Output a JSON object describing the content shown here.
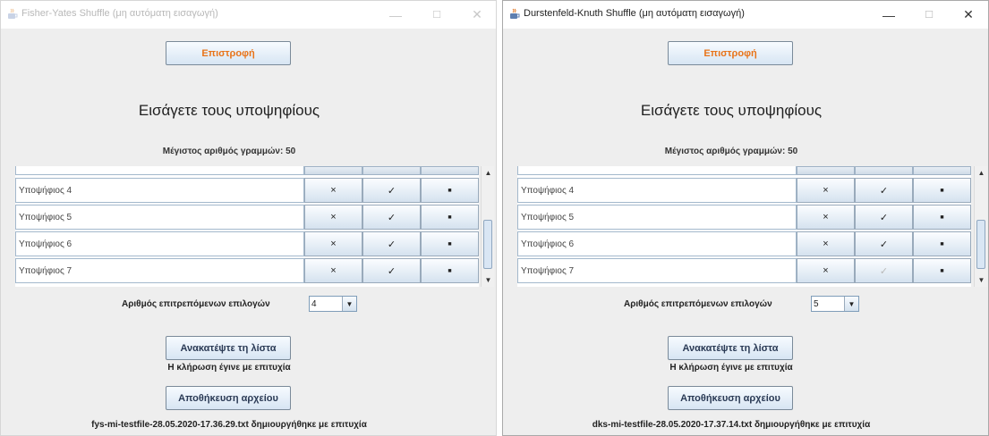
{
  "left": {
    "title": "Fisher-Yates Shuffle (μη αυτόματη εισαγωγή)",
    "back_button": "Επιστροφή",
    "heading": "Εισάγετε τους υποψηφίους",
    "max_lines": "Μέγιστος αριθμός γραμμών: 50",
    "rows": [
      {
        "name": "Υποψήφιος 4",
        "x": "×",
        "check": "✓",
        "dot": "■"
      },
      {
        "name": "Υποψήφιος 5",
        "x": "×",
        "check": "✓",
        "dot": "■"
      },
      {
        "name": "Υποψήφιος 6",
        "x": "×",
        "check": "✓",
        "dot": "■"
      },
      {
        "name": "Υποψήφιος 7",
        "x": "×",
        "check": "✓",
        "dot": "■"
      }
    ],
    "choices_label": "Αριθμός επιτρεπόμενων επιλογών",
    "choices_value": "4",
    "reload_button": "Ανακατέψτε τη λίστα",
    "draw_status": "Η κλήρωση έγινε με επιτυχία",
    "save_button": "Αποθήκευση αρχείου",
    "file_status": "fys-mi-testfile-28.05.2020-17.36.29.txt δημιουργήθηκε με επιτυχία"
  },
  "right": {
    "title": "Durstenfeld-Knuth Shuffle (μη αυτόματη εισαγωγή)",
    "back_button": "Επιστροφή",
    "heading": "Εισάγετε τους υποψηφίους",
    "max_lines": "Μέγιστος αριθμός γραμμών: 50",
    "rows": [
      {
        "name": "Υποψήφιος 4",
        "x": "×",
        "check": "✓",
        "dot": "■"
      },
      {
        "name": "Υποψήφιος 5",
        "x": "×",
        "check": "✓",
        "dot": "■"
      },
      {
        "name": "Υποψήφιος 6",
        "x": "×",
        "check": "✓",
        "dot": "■"
      },
      {
        "name": "Υποψήφιος 7",
        "x": "×",
        "check": "✓",
        "dot": "■"
      }
    ],
    "choices_label": "Αριθμός επιτρεπόμενων επιλογών",
    "choices_value": "5",
    "reload_button": "Ανακατέψτε τη λίστα",
    "draw_status": "Η κλήρωση έγινε με επιτυχία",
    "save_button": "Αποθήκευση αρχείου",
    "file_status": "dks-mi-testfile-28.05.2020-17.37.14.txt δημιουργήθηκε με επιτυχία"
  },
  "window_controls": {
    "minimize": "—",
    "maximize": "☐",
    "close": "✕"
  },
  "icons": {
    "app": "java-cup-icon",
    "scroll_up": "triangle-up-icon",
    "scroll_down": "triangle-down-icon",
    "dropdown": "triangle-down-icon"
  },
  "colors": {
    "accent_orange": "#e8741a",
    "window_bg": "#eeeeee",
    "button_border": "#7a8a99"
  }
}
